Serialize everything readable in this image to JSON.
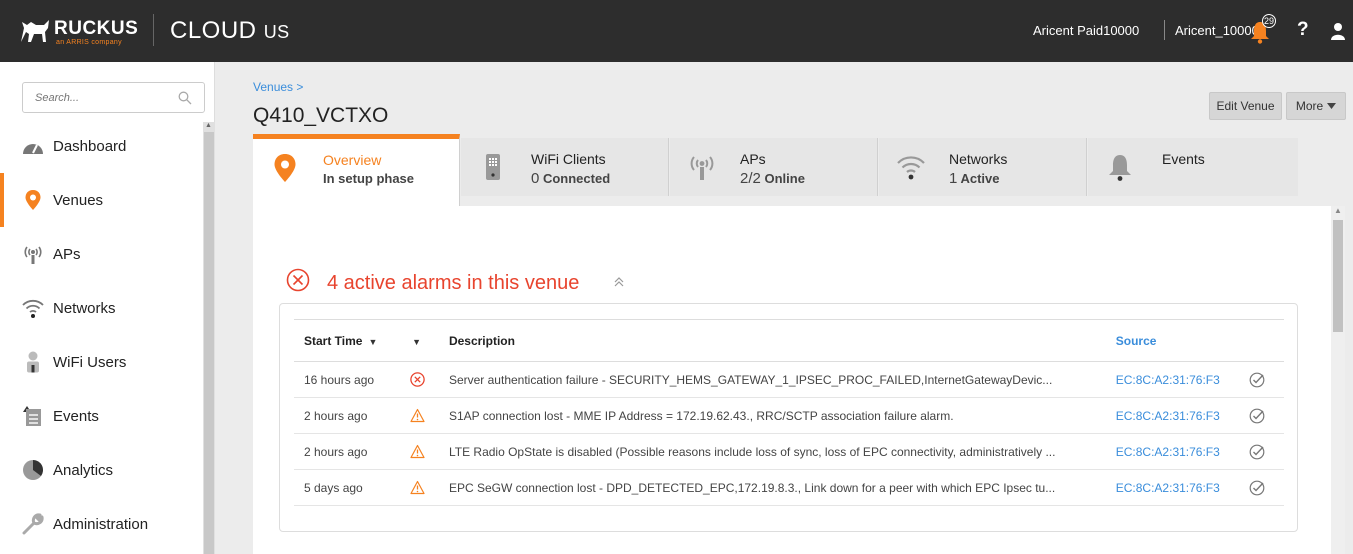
{
  "header": {
    "logo_text": "RUCKUS",
    "logo_sub": "an ARRIS company",
    "cloud_title": "CLOUD",
    "cloud_region": "US",
    "account_name": "Aricent Paid10000",
    "tenant_name": "Aricent_10000",
    "notification_count": "29",
    "help_label": "?"
  },
  "sidebar": {
    "search_placeholder": "Search...",
    "items": [
      {
        "label": "Dashboard",
        "icon": "dashboard-icon"
      },
      {
        "label": "Venues",
        "icon": "venue-pin-icon",
        "active": true
      },
      {
        "label": "APs",
        "icon": "ap-icon"
      },
      {
        "label": "Networks",
        "icon": "wifi-icon"
      },
      {
        "label": "WiFi Users",
        "icon": "user-icon"
      },
      {
        "label": "Events",
        "icon": "events-icon"
      },
      {
        "label": "Analytics",
        "icon": "analytics-pie-icon"
      },
      {
        "label": "Administration",
        "icon": "wrench-icon"
      }
    ]
  },
  "main": {
    "breadcrumb": "Venues >",
    "venue_name": "Q410_VCTXO",
    "edit_button": "Edit Venue",
    "more_button": "More",
    "tabs": [
      {
        "title": "Overview",
        "sub": "In setup phase",
        "icon": "venue-pin-icon"
      },
      {
        "title": "WiFi Clients",
        "count": "0",
        "sub": "Connected",
        "icon": "client-device-icon"
      },
      {
        "title": "APs",
        "count": "2/2",
        "sub": "Online",
        "icon": "ap-icon"
      },
      {
        "title": "Networks",
        "count": "1",
        "sub": "Active",
        "icon": "wifi-icon"
      },
      {
        "title": "Events",
        "icon": "bell-icon"
      }
    ]
  },
  "alarms": {
    "title": "4 active alarms in this venue",
    "columns": {
      "start_time": "Start Time",
      "description": "Description",
      "source": "Source"
    },
    "rows": [
      {
        "time": "16 hours ago",
        "severity": "critical",
        "description": "Server authentication failure - SECURITY_HEMS_GATEWAY_1_IPSEC_PROC_FAILED,InternetGatewayDevic...",
        "source": "EC:8C:A2:31:76:F3"
      },
      {
        "time": "2 hours ago",
        "severity": "warning",
        "description": "S1AP connection lost - MME IP Address = 172.19.62.43., RRC/SCTP association failure alarm.",
        "source": "EC:8C:A2:31:76:F3"
      },
      {
        "time": "2 hours ago",
        "severity": "warning",
        "description": "LTE Radio OpState is disabled (Possible reasons include loss of sync, loss of EPC connectivity, administratively ...",
        "source": "EC:8C:A2:31:76:F3"
      },
      {
        "time": "5 days ago",
        "severity": "warning",
        "description": "EPC SeGW connection lost - DPD_DETECTED_EPC,172.19.8.3., Link down for a peer with which EPC Ipsec tu...",
        "source": "EC:8C:A2:31:76:F3"
      }
    ]
  },
  "colors": {
    "accent": "#f58220",
    "topbar": "#2d2d2d",
    "alarm_red": "#e8442e",
    "link_blue": "#3a8ddb"
  }
}
